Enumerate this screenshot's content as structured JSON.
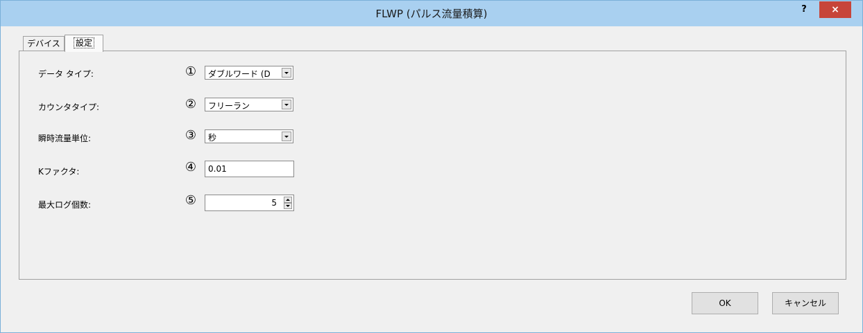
{
  "window": {
    "title": "FLWP (パルス流量積算)",
    "help_label": "?",
    "close_label": "×"
  },
  "tabs": [
    {
      "label": "デバイス",
      "active": false
    },
    {
      "label": "設定",
      "active": true
    }
  ],
  "settings": [
    {
      "label": "データ タイプ:",
      "number": "①",
      "control": "combo",
      "value": "ダブルワード (D"
    },
    {
      "label": "カウンタタイプ:",
      "number": "②",
      "control": "combo",
      "value": "フリーラン"
    },
    {
      "label": "瞬時流量単位:",
      "number": "③",
      "control": "combo",
      "value": "秒"
    },
    {
      "label": "Kファクタ:",
      "number": "④",
      "control": "text",
      "value": "0.01"
    },
    {
      "label": "最大ログ個数:",
      "number": "⑤",
      "control": "spin",
      "value": "5"
    }
  ],
  "buttons": {
    "ok_label": "OK",
    "cancel_label": "キャンセル"
  }
}
